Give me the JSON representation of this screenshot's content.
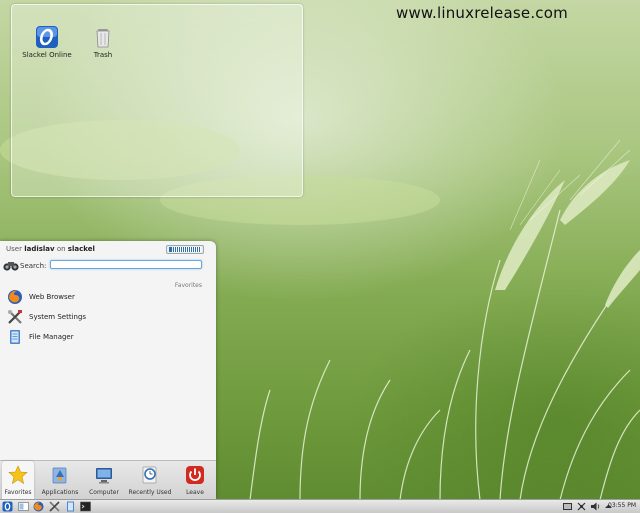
{
  "watermark": "www.linuxrelease.com",
  "desktop": {
    "icons": [
      {
        "label": "Slackel Online",
        "icon": "slackel-online-icon"
      },
      {
        "label": "Trash",
        "icon": "trash-icon"
      }
    ]
  },
  "kickoff": {
    "user_prefix": "User",
    "user_name": "ladislav",
    "on_text": "on",
    "host_name": "slackel",
    "search_label": "Search:",
    "search_value": "",
    "section_title": "Favorites",
    "favorites": [
      {
        "label": "Web Browser",
        "icon": "firefox-icon"
      },
      {
        "label": "System Settings",
        "icon": "system-settings-icon"
      },
      {
        "label": "File Manager",
        "icon": "file-manager-icon"
      }
    ],
    "tabs": [
      {
        "label": "Favorites",
        "icon": "star-icon",
        "active": true
      },
      {
        "label": "Applications",
        "icon": "applications-icon",
        "active": false
      },
      {
        "label": "Computer",
        "icon": "computer-icon",
        "active": false
      },
      {
        "label": "Recently Used",
        "icon": "recently-used-icon",
        "active": false
      },
      {
        "label": "Leave",
        "icon": "power-icon",
        "active": false
      }
    ]
  },
  "panel": {
    "clock": "03:55 PM"
  },
  "colors": {
    "accent": "#2d6db0",
    "leave_red": "#d32a1f"
  }
}
